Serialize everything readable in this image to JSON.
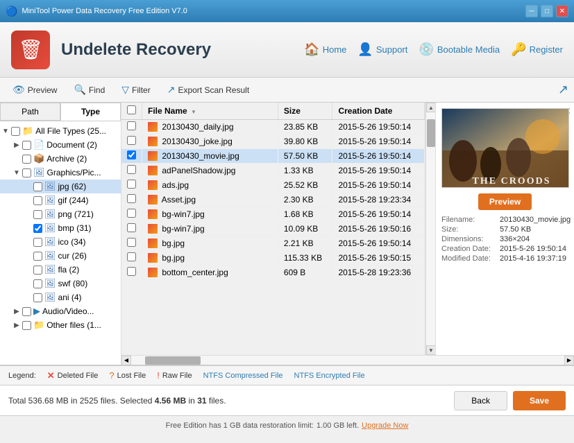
{
  "titleBar": {
    "title": "MiniTool Power Data Recovery Free Edition V7.0",
    "controls": [
      "minimize",
      "maximize",
      "close"
    ]
  },
  "header": {
    "logoAlt": "MiniTool Logo",
    "appTitle": "Undelete Recovery",
    "nav": [
      {
        "id": "home",
        "label": "Home",
        "icon": "🏠"
      },
      {
        "id": "support",
        "label": "Support",
        "icon": "👤"
      },
      {
        "id": "bootable",
        "label": "Bootable Media",
        "icon": "💿"
      },
      {
        "id": "register",
        "label": "Register",
        "icon": "🔑"
      }
    ]
  },
  "toolbar": {
    "buttons": [
      {
        "id": "preview",
        "label": "Preview",
        "icon": "👁"
      },
      {
        "id": "find",
        "label": "Find",
        "icon": "🔍"
      },
      {
        "id": "filter",
        "label": "Filter",
        "icon": "▽"
      },
      {
        "id": "export",
        "label": "Export Scan Result",
        "icon": "↗"
      }
    ]
  },
  "tabs": {
    "path": "Path",
    "type": "Type",
    "active": "type"
  },
  "tree": {
    "items": [
      {
        "id": "all",
        "label": "All File Types (25...",
        "level": 0,
        "expanded": true,
        "checked": false,
        "hasToggle": true,
        "icon": "folder"
      },
      {
        "id": "document",
        "label": "Document (2)",
        "level": 1,
        "expanded": false,
        "checked": false,
        "hasToggle": true,
        "icon": "doc"
      },
      {
        "id": "archive",
        "label": "Archive (2)",
        "level": 1,
        "expanded": false,
        "checked": false,
        "hasToggle": false,
        "icon": "archive"
      },
      {
        "id": "graphics",
        "label": "Graphics/Pic...",
        "level": 1,
        "expanded": true,
        "checked": false,
        "hasToggle": true,
        "icon": "image"
      },
      {
        "id": "jpg",
        "label": "jpg (62)",
        "level": 2,
        "expanded": false,
        "checked": false,
        "hasToggle": false,
        "icon": "jpg",
        "selected": true
      },
      {
        "id": "gif",
        "label": "gif (244)",
        "level": 2,
        "expanded": false,
        "checked": false,
        "hasToggle": false,
        "icon": "jpg"
      },
      {
        "id": "png",
        "label": "png (721)",
        "level": 2,
        "expanded": false,
        "checked": false,
        "hasToggle": false,
        "icon": "jpg"
      },
      {
        "id": "bmp",
        "label": "bmp (31)",
        "level": 2,
        "expanded": false,
        "checked": true,
        "hasToggle": false,
        "icon": "jpg"
      },
      {
        "id": "ico",
        "label": "ico (34)",
        "level": 2,
        "expanded": false,
        "checked": false,
        "hasToggle": false,
        "icon": "jpg"
      },
      {
        "id": "cur",
        "label": "cur (26)",
        "level": 2,
        "expanded": false,
        "checked": false,
        "hasToggle": false,
        "icon": "jpg"
      },
      {
        "id": "fla",
        "label": "fla (2)",
        "level": 2,
        "expanded": false,
        "checked": false,
        "hasToggle": false,
        "icon": "jpg"
      },
      {
        "id": "swf",
        "label": "swf (80)",
        "level": 2,
        "expanded": false,
        "checked": false,
        "hasToggle": false,
        "icon": "jpg"
      },
      {
        "id": "ani",
        "label": "ani (4)",
        "level": 2,
        "expanded": false,
        "checked": false,
        "hasToggle": false,
        "icon": "jpg"
      },
      {
        "id": "audio",
        "label": "Audio/Video...",
        "level": 1,
        "expanded": false,
        "checked": false,
        "hasToggle": true,
        "icon": "audio"
      },
      {
        "id": "other",
        "label": "Other files (1...",
        "level": 1,
        "expanded": false,
        "checked": false,
        "hasToggle": true,
        "icon": "folder"
      }
    ]
  },
  "fileList": {
    "columns": [
      "File Name",
      "Size",
      "Creation Date"
    ],
    "files": [
      {
        "name": "20130430_daily.jpg",
        "size": "23.85 KB",
        "date": "2015-5-26 19:50:14",
        "selected": false
      },
      {
        "name": "20130430_joke.jpg",
        "size": "39.80 KB",
        "date": "2015-5-26 19:50:14",
        "selected": false
      },
      {
        "name": "20130430_movie.jpg",
        "size": "57.50 KB",
        "date": "2015-5-26 19:50:14",
        "selected": true
      },
      {
        "name": "adPanelShadow.jpg",
        "size": "1.33 KB",
        "date": "2015-5-26 19:50:14",
        "selected": false
      },
      {
        "name": "ads.jpg",
        "size": "25.52 KB",
        "date": "2015-5-26 19:50:14",
        "selected": false
      },
      {
        "name": "Asset.jpg",
        "size": "2.30 KB",
        "date": "2015-5-28 19:23:34",
        "selected": false
      },
      {
        "name": "bg-win7.jpg",
        "size": "1.68 KB",
        "date": "2015-5-26 19:50:14",
        "selected": false
      },
      {
        "name": "bg-win7.jpg",
        "size": "10.09 KB",
        "date": "2015-5-26 19:50:16",
        "selected": false
      },
      {
        "name": "bg.jpg",
        "size": "2.21 KB",
        "date": "2015-5-26 19:50:14",
        "selected": false
      },
      {
        "name": "bg.jpg",
        "size": "115.33 KB",
        "date": "2015-5-26 19:50:15",
        "selected": false
      },
      {
        "name": "bottom_center.jpg",
        "size": "609 B",
        "date": "2015-5-28 19:23:36",
        "selected": false
      }
    ]
  },
  "preview": {
    "filename": "20130430_movie.jpg",
    "size": "57.50 KB",
    "dimensions": "336×204",
    "creationDate": "2015-5-26 19:50:14",
    "modifiedDate": "2015-4-16 19:37:19",
    "buttonLabel": "Preview",
    "labels": {
      "filename": "Filename:",
      "size": "Size:",
      "dimensions": "Dimensions:",
      "creationDate": "Creation Date:",
      "modifiedDate": "Modified Date:"
    }
  },
  "legend": {
    "items": [
      {
        "id": "deleted",
        "symbol": "✕",
        "label": "Deleted File",
        "color": "#e74c3c"
      },
      {
        "id": "lost",
        "symbol": "?",
        "label": "Lost File",
        "color": "#e07020"
      },
      {
        "id": "raw",
        "symbol": "!",
        "label": "Raw File",
        "color": "#e74c3c"
      },
      {
        "id": "ntfs-comp",
        "label": "NTFS Compressed File",
        "color": "#2d7db3"
      },
      {
        "id": "ntfs-enc",
        "label": "NTFS Encrypted File",
        "color": "#2d7db3"
      }
    ],
    "legendLabel": "Legend:"
  },
  "statusBar": {
    "totalText": "Total 536.68 MB in 2525 files. Selected",
    "selectedText": "4.56 MB",
    "selectedSuffix": "in",
    "fileCount": "31",
    "filesSuffix": "files.",
    "backLabel": "Back",
    "saveLabel": "Save"
  },
  "bottomNotice": {
    "text": "Free Edition has 1 GB data restoration limit:",
    "limitText": "1.00 GB left.",
    "linkText": "Upgrade Now"
  }
}
